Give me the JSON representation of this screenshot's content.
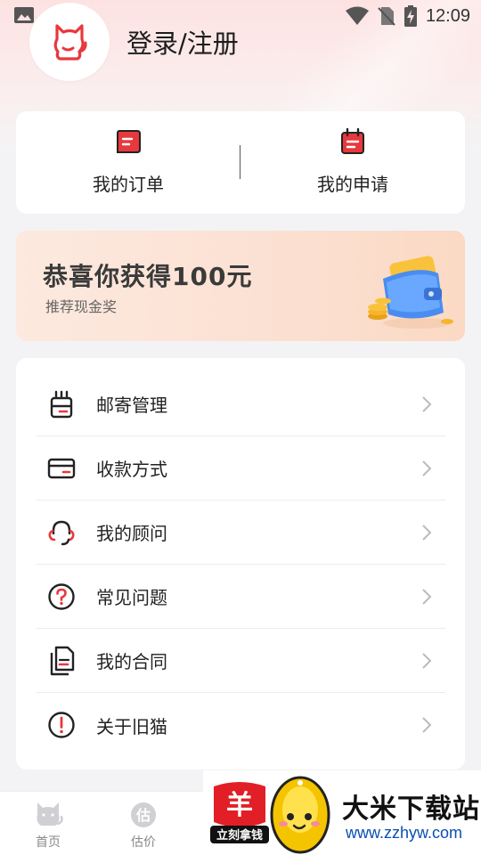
{
  "status_bar": {
    "time": "12:09"
  },
  "header": {
    "login_title": "登录/注册"
  },
  "orders": {
    "items": [
      {
        "label": "我的订单",
        "icon": "order-icon"
      },
      {
        "label": "我的申请",
        "icon": "application-icon"
      }
    ]
  },
  "banner": {
    "title": "恭喜你获得100元",
    "subtitle": "推荐现金奖"
  },
  "menu": {
    "items": [
      {
        "label": "邮寄管理",
        "icon": "mailing-icon"
      },
      {
        "label": "收款方式",
        "icon": "card-icon"
      },
      {
        "label": "我的顾问",
        "icon": "headset-icon"
      },
      {
        "label": "常见问题",
        "icon": "question-icon"
      },
      {
        "label": "我的合同",
        "icon": "contract-icon"
      },
      {
        "label": "关于旧猫",
        "icon": "info-icon"
      }
    ]
  },
  "bottom_nav": {
    "items": [
      {
        "label": "首页",
        "icon": "cat-home-icon"
      },
      {
        "label": "估价",
        "icon": "estimate-icon"
      }
    ]
  },
  "watermark": {
    "badge_char": "羊",
    "badge_text": "立刻拿钱",
    "site_name": "大米下载站",
    "site_url": "www.zzhyw.com"
  },
  "colors": {
    "accent_red": "#e8383d",
    "header_gradient_top": "#fde2e2",
    "banner_bg": "#fbe1d3",
    "url_blue": "#0a4fb3"
  }
}
